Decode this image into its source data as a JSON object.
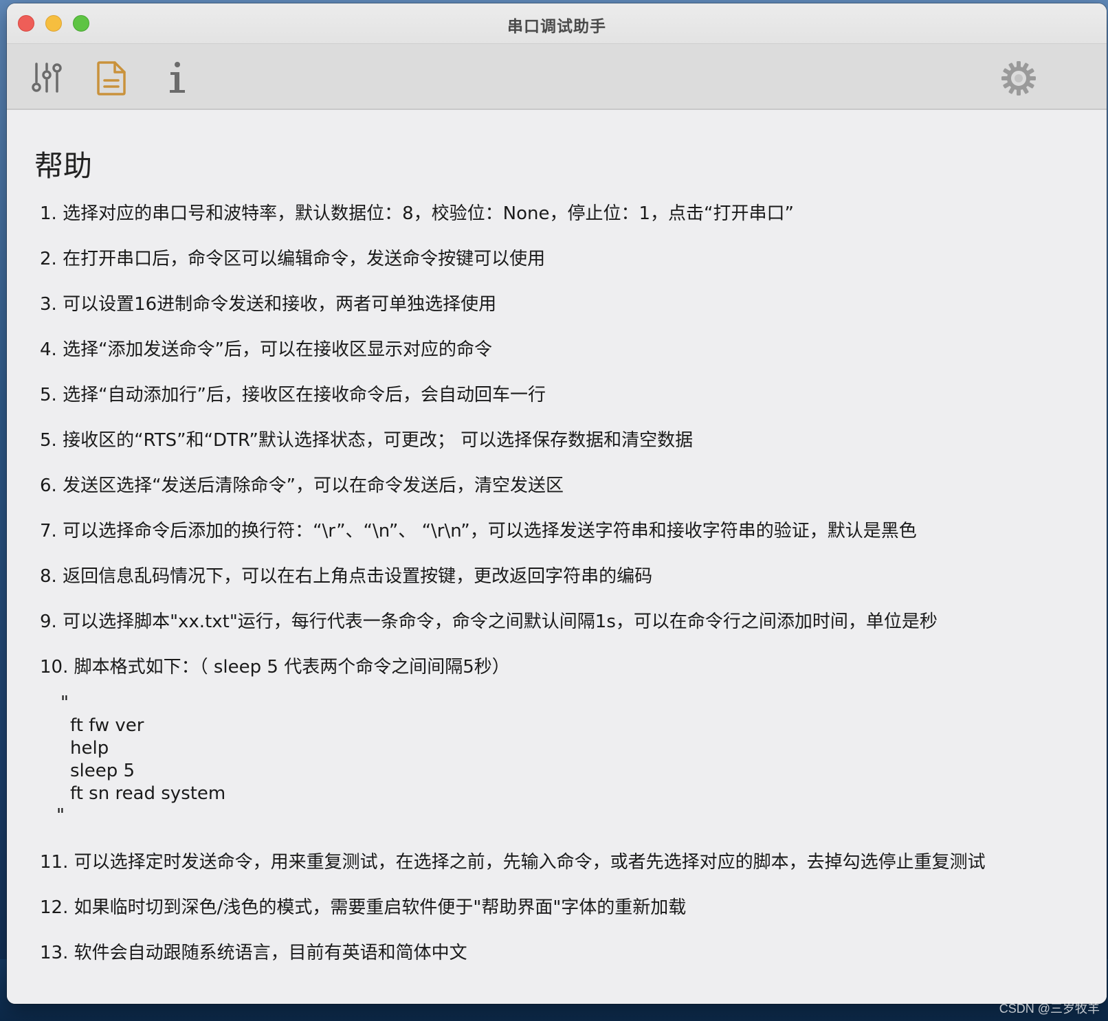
{
  "window": {
    "title": "串口调试助手"
  },
  "toolbar": {
    "buttons": [
      {
        "name": "sliders-icon",
        "state": "inactive"
      },
      {
        "name": "document-icon",
        "state": "active"
      },
      {
        "name": "info-icon",
        "state": "inactive"
      },
      {
        "name": "gear-icon",
        "state": "inactive"
      }
    ],
    "accent_color": "#c9923c"
  },
  "help": {
    "title": "帮助",
    "items": [
      "1. 选择对应的串口号和波特率，默认数据位：8，校验位：None，停止位：1，点击“打开串口”",
      "2. 在打开串口后，命令区可以编辑命令，发送命令按键可以使用",
      "3. 可以设置16进制命令发送和接收，两者可单独选择使用",
      "4. 选择“添加发送命令”后，可以在接收区显示对应的命令",
      "5. 选择“自动添加行”后，接收区在接收命令后，会自动回车一行",
      "5. 接收区的“RTS”和“DTR”默认选择状态，可更改；  可以选择保存数据和清空数据",
      "6. 发送区选择“发送后清除命令”，可以在命令发送后，清空发送区",
      "7. 可以选择命令后添加的换行符：“\\r”、“\\n”、 “\\r\\n”，可以选择发送字符串和接收字符串的验证，默认是黑色",
      "8. 返回信息乱码情况下，可以在右上角点击设置按键，更改返回字符串的编码",
      "9. 可以选择脚本\"xx.txt\"运行，每行代表一条命令，命令之间默认间隔1s，可以在命令行之间添加时间，单位是秒",
      "10. 脚本格式如下：（ sleep 5 代表两个命令之间间隔5秒）"
    ],
    "script_example": {
      "open_quote": "\"",
      "lines": [
        "ft fw ver",
        "help",
        "sleep 5",
        "ft sn read system"
      ],
      "close_quote": "\""
    },
    "items_after": [
      "11. 可以选择定时发送命令，用来重复测试，在选择之前，先输入命令，或者先选择对应的脚本，去掉勾选停止重复测试",
      "12. 如果临时切到深色/浅色的模式，需要重启软件便于\"帮助界面\"字体的重新加载",
      "13. 软件会自动跟随系统语言，目前有英语和简体中文"
    ]
  },
  "watermark": "CSDN @三岁牧羊"
}
